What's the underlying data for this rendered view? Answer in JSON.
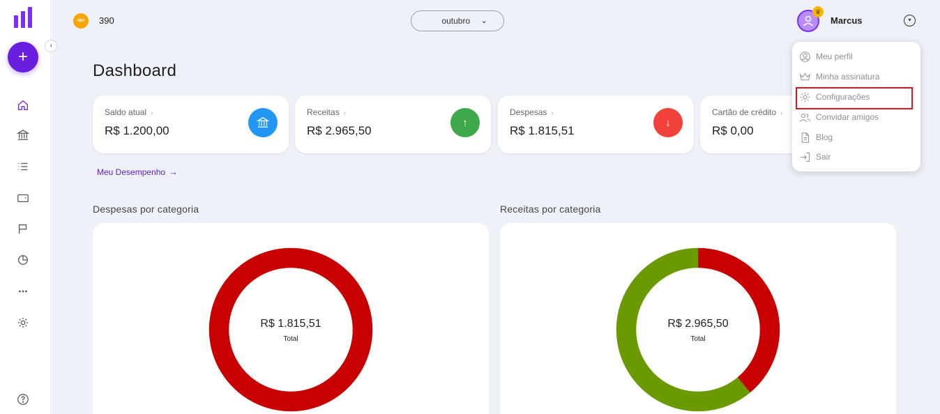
{
  "topbar": {
    "coin_text": "MB3",
    "points": "390",
    "month": "outubro",
    "username": "Marcus"
  },
  "page": {
    "title": "Dashboard"
  },
  "cards": [
    {
      "label": "Saldo atual",
      "value": "R$ 1.200,00",
      "icon": "bank-icon",
      "color": "#2196f3"
    },
    {
      "label": "Receitas",
      "value": "R$ 2.965,50",
      "icon": "arrow-up-icon",
      "color": "#3fa84a"
    },
    {
      "label": "Despesas",
      "value": "R$ 1.815,51",
      "icon": "arrow-down-icon",
      "color": "#f2403a"
    },
    {
      "label": "Cartão de crédito",
      "value": "R$ 0,00",
      "icon": "credit-card-icon",
      "color": "#7b2ff7"
    }
  ],
  "performance_link": "Meu Desempenho",
  "sections": {
    "expenses_title": "Despesas por categoria",
    "income_title": "Receitas por categoria"
  },
  "charts": {
    "expenses": {
      "total": "R$ 1.815,51",
      "caption": "Total"
    },
    "income": {
      "total": "R$ 2.965,50",
      "caption": "Total"
    }
  },
  "chart_data": [
    {
      "type": "pie",
      "title": "Despesas por categoria",
      "categories": [
        "",
        ""
      ],
      "values": [
        1.1,
        98.9
      ],
      "colors": [
        "#c90000",
        "#c90000"
      ],
      "center_label": "R$ 1.815,51",
      "center_caption": "Total"
    },
    {
      "type": "pie",
      "title": "Receitas por categoria",
      "categories": [
        "",
        ""
      ],
      "values": [
        39,
        61
      ],
      "colors": [
        "#c90000",
        "#6a9a00"
      ],
      "center_label": "R$ 2.965,50",
      "center_caption": "Total"
    }
  ],
  "user_menu": {
    "items": [
      {
        "label": "Meu perfil",
        "icon": "user-circle-icon"
      },
      {
        "label": "Minha assinatura",
        "icon": "crown-icon"
      },
      {
        "label": "Configurações",
        "icon": "gear-icon"
      },
      {
        "label": "Convidar amigos",
        "icon": "users-icon"
      },
      {
        "label": "Blog",
        "icon": "document-icon"
      },
      {
        "label": "Sair",
        "icon": "logout-icon"
      }
    ],
    "highlighted": "Configurações",
    "highlight_color": "#e0141e"
  },
  "sidebar": {
    "items": [
      "home-icon",
      "bank-icon",
      "list-icon",
      "wallet-icon",
      "flag-icon",
      "pie-chart-icon",
      "more-icon",
      "gear-icon"
    ],
    "help": "help-icon",
    "accent": "#6a1fe0"
  }
}
